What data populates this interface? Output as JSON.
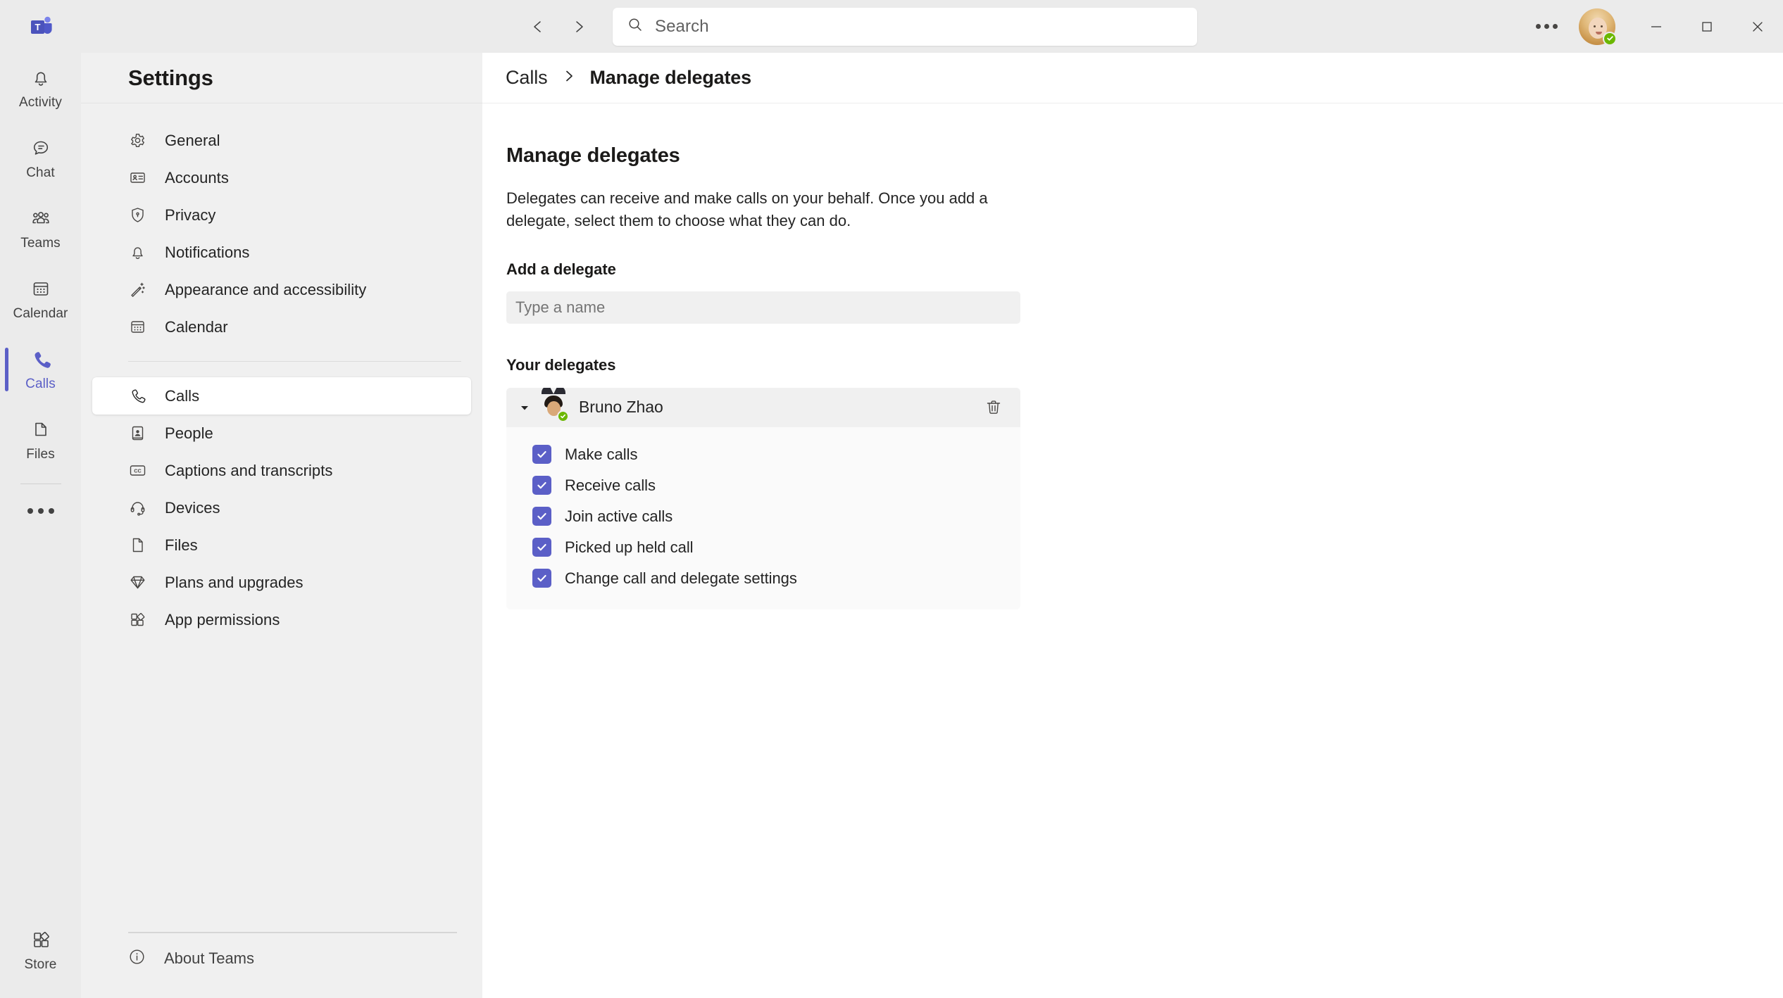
{
  "titlebar": {
    "logo_icon": "teams-logo-icon",
    "back_icon": "chevron-left-icon",
    "forward_icon": "chevron-right-icon",
    "search_placeholder": "Search",
    "search_value": "",
    "search_icon": "search-icon",
    "more_icon": "ellipsis-horizontal-icon",
    "avatar_icon": "user-avatar",
    "presence_status": "available",
    "minimize_icon": "minimize-icon",
    "maximize_icon": "maximize-icon",
    "close_icon": "close-icon"
  },
  "rail": {
    "items": [
      {
        "label": "Activity",
        "icon": "bell-icon",
        "active": false
      },
      {
        "label": "Chat",
        "icon": "chat-bubble-icon",
        "active": false
      },
      {
        "label": "Teams",
        "icon": "people-group-icon",
        "active": false
      },
      {
        "label": "Calendar",
        "icon": "calendar-icon",
        "active": false
      },
      {
        "label": "Calls",
        "icon": "phone-icon",
        "active": true
      },
      {
        "label": "Files",
        "icon": "document-icon",
        "active": false
      }
    ],
    "more_icon": "ellipsis-horizontal-icon",
    "store": {
      "label": "Store",
      "icon": "store-icon"
    }
  },
  "settings": {
    "title": "Settings",
    "group1": [
      {
        "label": "General",
        "icon": "gear-icon"
      },
      {
        "label": "Accounts",
        "icon": "id-card-icon"
      },
      {
        "label": "Privacy",
        "icon": "shield-lock-icon"
      },
      {
        "label": "Notifications",
        "icon": "bell-icon"
      },
      {
        "label": "Appearance and accessibility",
        "icon": "magic-wand-icon"
      },
      {
        "label": "Calendar",
        "icon": "calendar-icon"
      }
    ],
    "group2": [
      {
        "label": "Calls",
        "icon": "phone-icon",
        "selected": true
      },
      {
        "label": "People",
        "icon": "contact-card-icon",
        "selected": false
      },
      {
        "label": "Captions and transcripts",
        "icon": "closed-caption-icon",
        "selected": false
      },
      {
        "label": "Devices",
        "icon": "headset-icon",
        "selected": false
      },
      {
        "label": "Files",
        "icon": "document-icon",
        "selected": false
      },
      {
        "label": "Plans and upgrades",
        "icon": "diamond-icon",
        "selected": false
      },
      {
        "label": "App permissions",
        "icon": "apps-icon",
        "selected": false
      }
    ],
    "about": {
      "label": "About Teams",
      "icon": "info-circle-icon"
    }
  },
  "breadcrumb": {
    "parent": "Calls",
    "separator_icon": "chevron-right-icon",
    "current": "Manage delegates"
  },
  "main": {
    "page_title": "Manage delegates",
    "description": "Delegates can receive and make calls on your behalf. Once you add a delegate, select them to choose what they can do.",
    "add_delegate_label": "Add a delegate",
    "add_delegate_placeholder": "Type a name",
    "add_delegate_value": "",
    "your_delegates_label": "Your delegates",
    "delegate": {
      "name": "Bruno Zhao",
      "presence_status": "available",
      "expanded": true,
      "expand_icon": "chevron-down-icon",
      "delete_icon": "trash-icon",
      "permissions": [
        {
          "label": "Make calls",
          "checked": true
        },
        {
          "label": "Receive calls",
          "checked": true
        },
        {
          "label": "Join active calls",
          "checked": true
        },
        {
          "label": "Picked up held call",
          "checked": true
        },
        {
          "label": "Change call and delegate settings",
          "checked": true
        }
      ]
    }
  },
  "colors": {
    "accent": "#5B5FC7",
    "presence_available": "#6BB700",
    "app_background": "#ebebeb",
    "panel_background": "#f0f0f0",
    "content_background": "#ffffff"
  }
}
